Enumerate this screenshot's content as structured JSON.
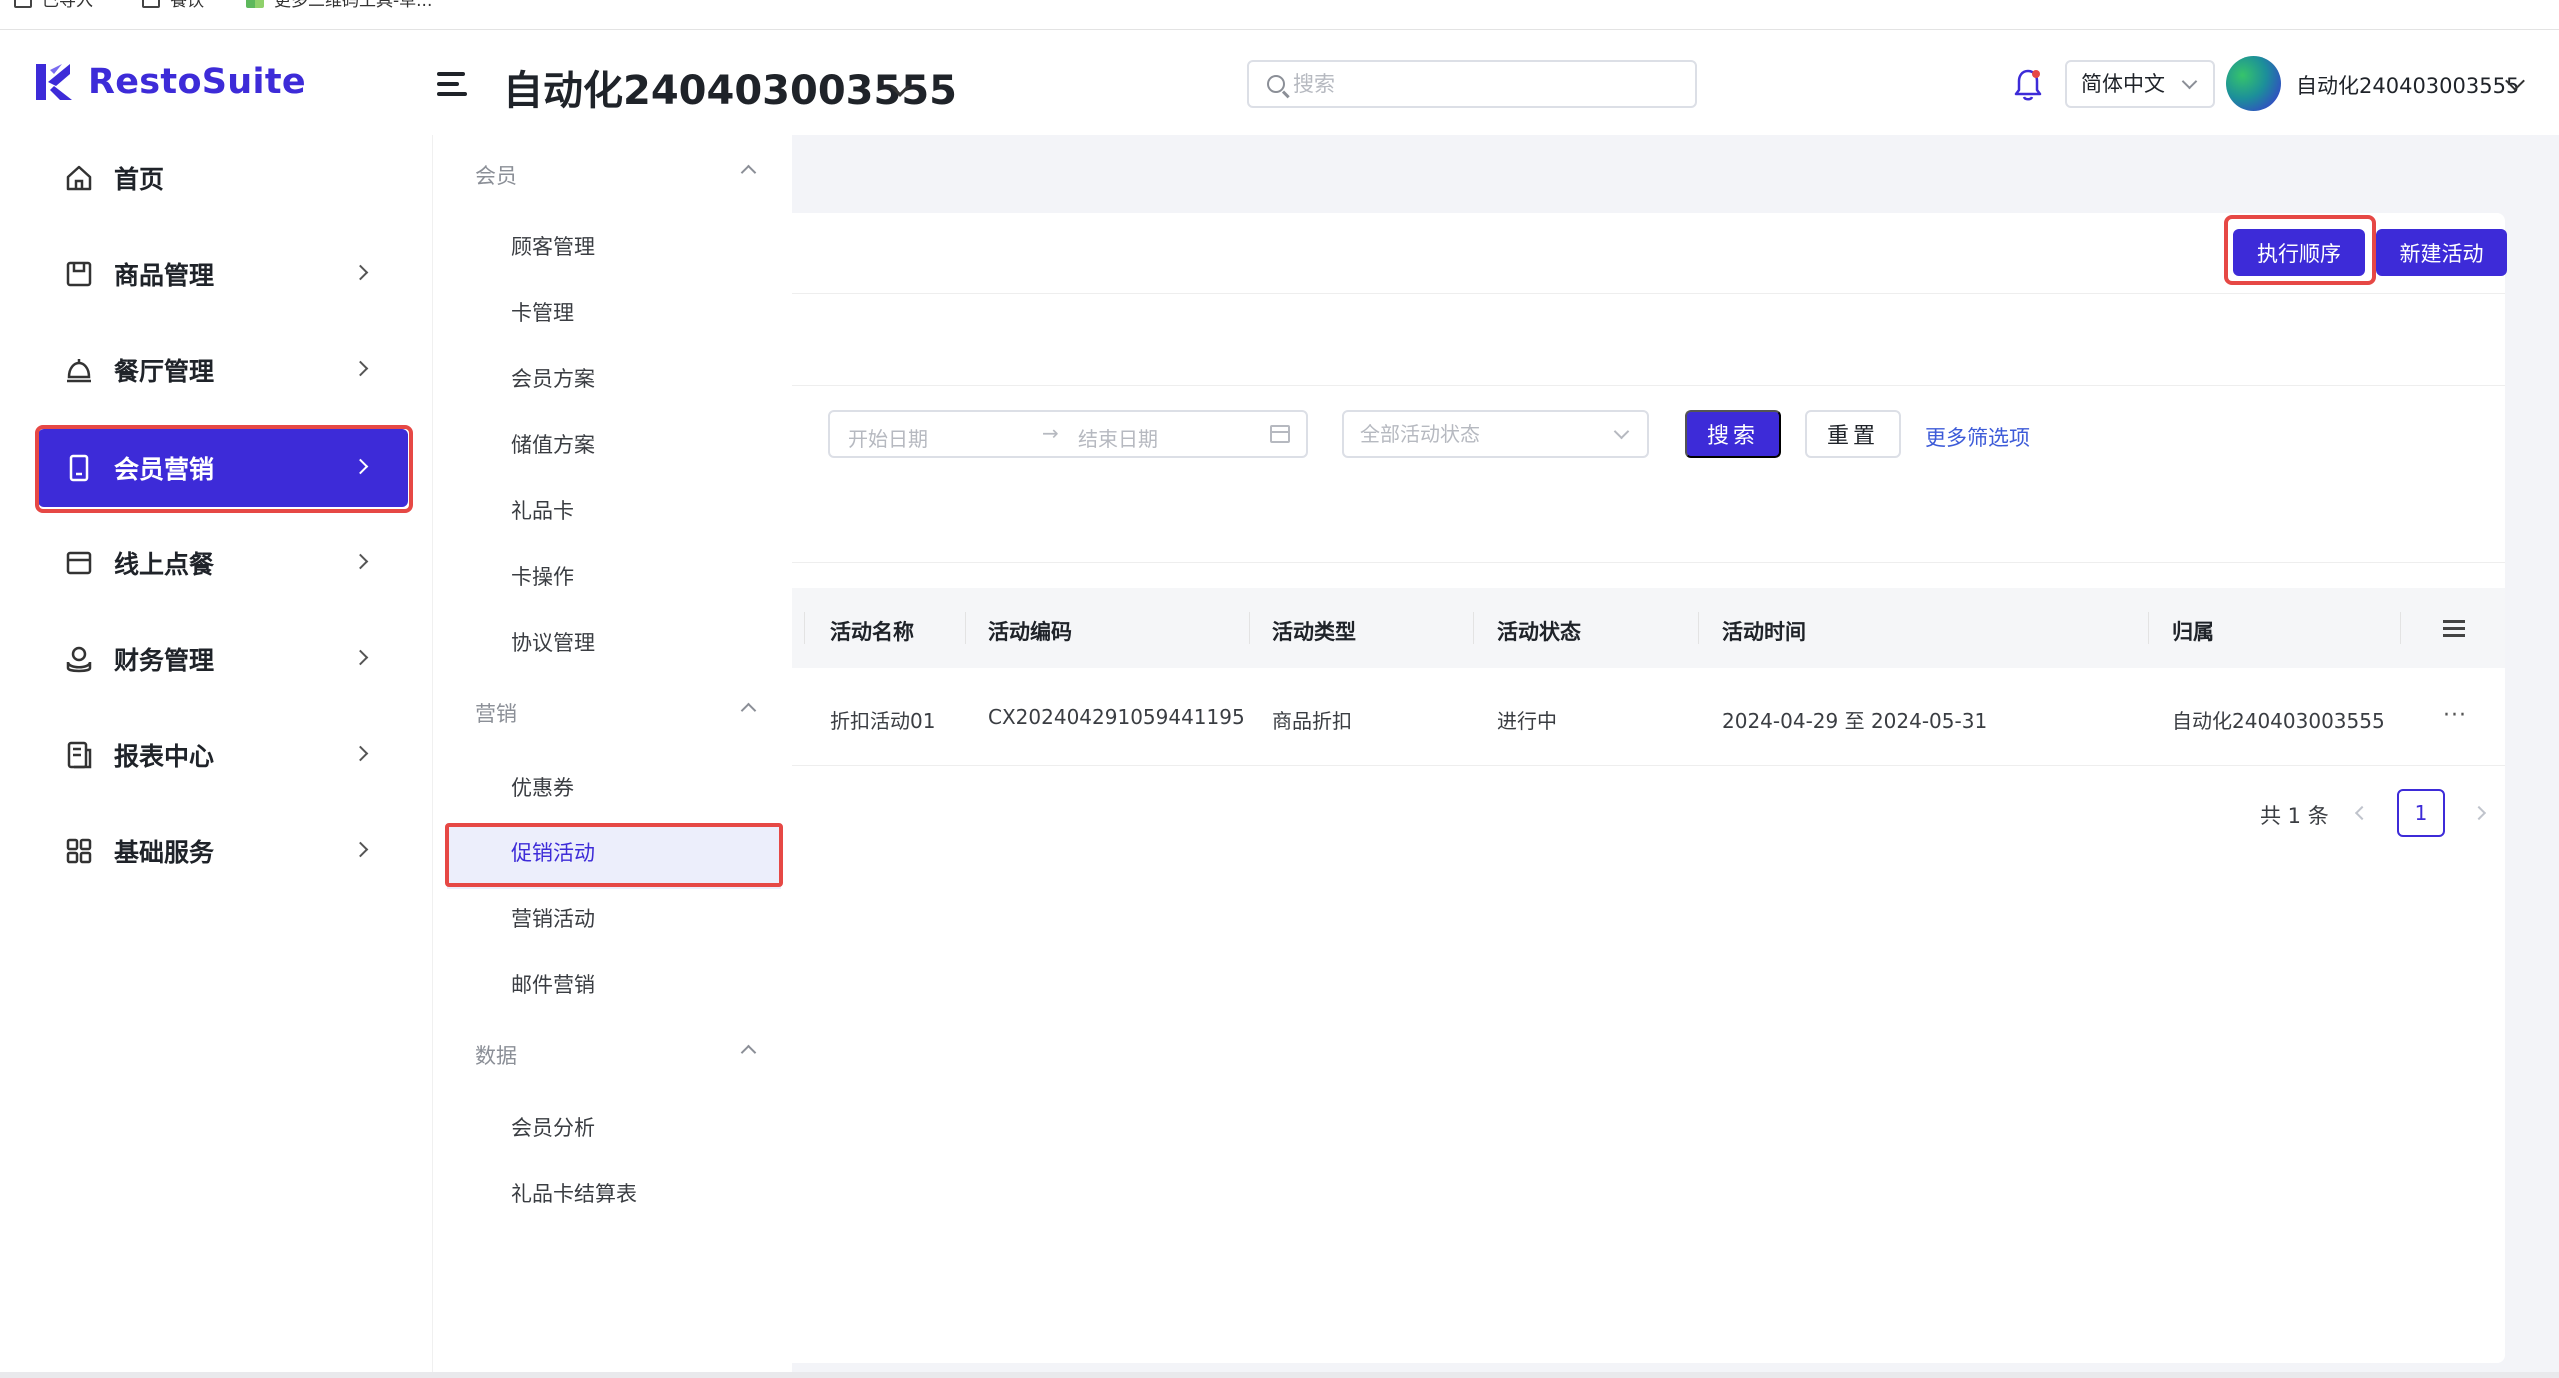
{
  "bookmarks": [
    {
      "label": "已导入",
      "icon": "folder-icon"
    },
    {
      "label": "餐饮",
      "icon": "folder-icon"
    },
    {
      "label": "更多二维码工具-草...",
      "icon": "app-icon"
    }
  ],
  "header": {
    "brand": "RestoSuite",
    "store_title": "自动化240403003555",
    "search_placeholder": "搜索",
    "language": "简体中文",
    "user_name": "自动化240403003555"
  },
  "sidebar": {
    "items": [
      {
        "label": "首页",
        "icon": "home-icon",
        "has_children": false
      },
      {
        "label": "商品管理",
        "icon": "product-icon",
        "has_children": true
      },
      {
        "label": "餐厅管理",
        "icon": "restaurant-icon",
        "has_children": true
      },
      {
        "label": "会员营销",
        "icon": "member-icon",
        "has_children": true,
        "active": true
      },
      {
        "label": "线上点餐",
        "icon": "online-order-icon",
        "has_children": true
      },
      {
        "label": "财务管理",
        "icon": "finance-icon",
        "has_children": true
      },
      {
        "label": "报表中心",
        "icon": "report-icon",
        "has_children": true
      },
      {
        "label": "基础服务",
        "icon": "grid-icon",
        "has_children": true
      }
    ]
  },
  "submenu": {
    "groups": [
      {
        "title": "会员",
        "items": [
          "顾客管理",
          "卡管理",
          "会员方案",
          "储值方案",
          "礼品卡",
          "卡操作",
          "协议管理"
        ]
      },
      {
        "title": "营销",
        "items": [
          "优惠券",
          "促销活动",
          "营销活动",
          "邮件营销"
        ]
      },
      {
        "title": "数据",
        "items": [
          "会员分析",
          "礼品卡结算表"
        ]
      }
    ],
    "active_item": "促销活动"
  },
  "toolbar": {
    "exec_order_label": "执行顺序",
    "new_activity_label": "新建活动"
  },
  "filters": {
    "start_date_placeholder": "开始日期",
    "end_date_placeholder": "结束日期",
    "range_arrow": "→",
    "status_placeholder": "全部活动状态",
    "search_label": "搜索",
    "reset_label": "重置",
    "more_filters_label": "更多筛选项"
  },
  "table": {
    "columns": [
      "活动名称",
      "活动编码",
      "活动类型",
      "活动状态",
      "活动时间",
      "归属"
    ],
    "rows": [
      {
        "name": "折扣活动01",
        "code": "CX202404291059441195",
        "type": "商品折扣",
        "status": "进行中",
        "time": "2024-04-29 至 2024-05-31",
        "owner": "自动化240403003555",
        "more": "···"
      }
    ]
  },
  "pagination": {
    "total_text": "共 1 条",
    "current_page": "1"
  },
  "colors": {
    "brand": "#3d2bd8",
    "highlight_outline": "#e64845",
    "link": "#3d5bd8"
  }
}
